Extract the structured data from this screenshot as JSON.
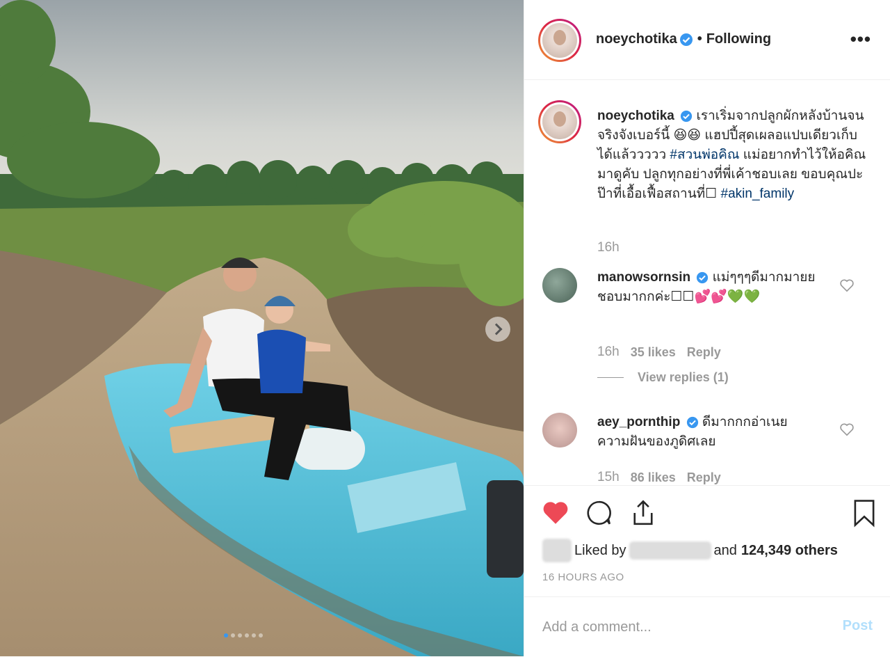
{
  "header": {
    "username": "noeychotika",
    "separator": "•",
    "follow_status": "Following",
    "more_label": "•••"
  },
  "caption": {
    "username": "noeychotika",
    "text": "เราเริ่มจากปลูกผักหลังบ้านจนจริงจังเบอร์นี้ 😆😆 แฮปปี้สุดเผลอแปบเดียวเก็บได้แล้ววววว",
    "hashtag1": "#สวนพ่อคิณ",
    "text2": "แม่อยากทำไว้ให้อคิณมาดูคับ ปลูกทุกอย่างที่พี่เค้าชอบเลย ขอบคุณปะป๊าที่เอื้อเฟื้อสถานที่☐",
    "hashtag2": "#akin_family",
    "time": "16h"
  },
  "comments": [
    {
      "username": "manowsornsin",
      "text": "แม่ๆๆๆดีมากมายย ชอบมากกค่ะ☐☐💕💕💚💚",
      "time": "16h",
      "likes": "35 likes",
      "reply": "Reply",
      "view_replies": "View replies (1)"
    },
    {
      "username": "aey_pornthip",
      "text": "ดีมากกกอ่าเนยความฝันของภูดิศเลย",
      "time": "15h",
      "likes": "86 likes",
      "reply": "Reply"
    }
  ],
  "likes": {
    "prefix": "Liked by",
    "connector": "and",
    "count": "124,349 others"
  },
  "timestamp": "16 HOURS AGO",
  "add_comment": {
    "placeholder": "Add a comment...",
    "post_label": "Post"
  },
  "carousel": {
    "slide_count": 6,
    "active_index": 0
  },
  "colors": {
    "liked": "#ed4956",
    "link": "#003569",
    "verified": "#3897f0",
    "post_disabled": "#b2dffc"
  }
}
